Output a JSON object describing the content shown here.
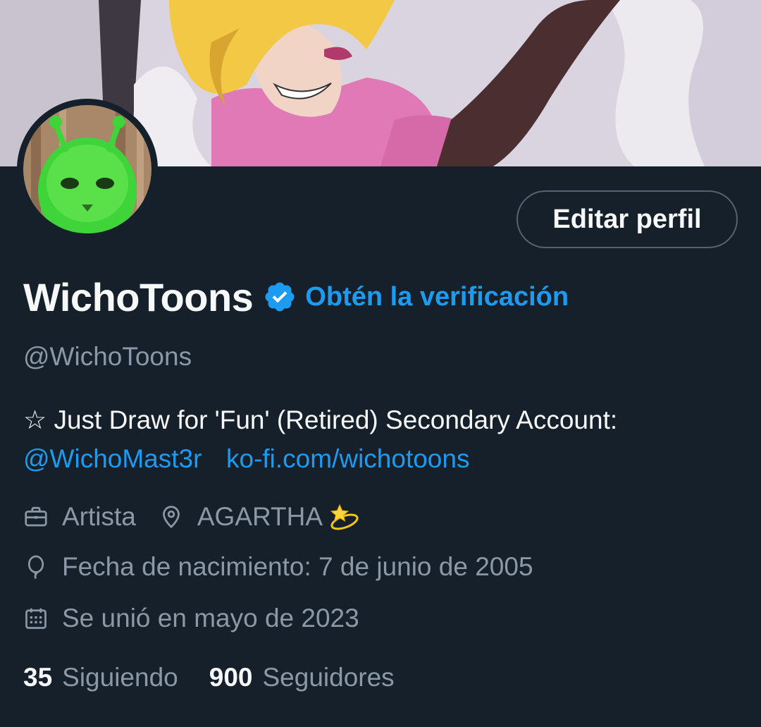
{
  "profile": {
    "display_name": "WichoToons",
    "verified_icon": "verified-badge-icon",
    "get_verified_label": "Obtén la verificación",
    "handle": "@WichoToons",
    "edit_profile_label": "Editar perfil",
    "bio": {
      "text": "☆ Just Draw for 'Fun' (Retired)  Secondary Account:",
      "mention": "@WichoMast3r",
      "link": "ko-fi.com/wichotoons"
    },
    "profession": "Artista",
    "location": "AGARTHA",
    "location_emoji": "dizzy-emoji-icon",
    "birthday": "Fecha de nacimiento: 7 de junio de 2005",
    "joined": "Se unió en mayo de 2023",
    "following_count": "35",
    "following_label": "Siguiendo",
    "followers_count": "900",
    "followers_label": "Seguidores"
  },
  "colors": {
    "background": "#15202b",
    "accent": "#1d9bf0",
    "secondary_text": "#8b98a5",
    "primary_text": "#f7f9f9",
    "button_border": "#536471"
  }
}
